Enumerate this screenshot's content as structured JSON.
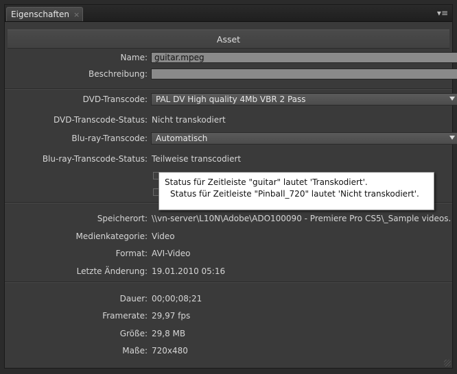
{
  "panel": {
    "tab_label": "Eigenschaften",
    "tab_close": "×",
    "menu_icon": "▾≡"
  },
  "section": {
    "title": "Asset"
  },
  "fields": {
    "name_label": "Name:",
    "name_value": "guitar.mpeg",
    "description_label": "Beschreibung:",
    "description_value": "",
    "dvd_transcode_label": "DVD-Transcode:",
    "dvd_transcode_value": "PAL DV High quality 4Mb VBR 2 Pass",
    "dvd_status_label": "DVD-Transcode-Status:",
    "dvd_status_value": "Nicht transkodiert",
    "bluray_transcode_label": "Blu-ray-Transcode:",
    "bluray_transcode_value": "Automatisch",
    "bluray_status_label": "Blu-ray-Transcode-Status:",
    "bluray_status_value": "Teilweise transcodiert"
  },
  "tooltip": {
    "line1": "Status für Zeitleiste \"guitar\" lautet 'Transkodiert'.",
    "line2": "Status für Zeitleiste \"Pinball_720\" lautet 'Nicht transkodiert'."
  },
  "file_info": {
    "location_label": "Speicherort:",
    "location_value": "\\\\vn-server\\L10N\\Adobe\\ADO100090 - Premiere Pro CS5\\_Sample videos...",
    "media_category_label": "Medienkategorie:",
    "media_category_value": "Video",
    "format_label": "Format:",
    "format_value": "AVI-Video",
    "last_modified_label": "Letzte Änderung:",
    "last_modified_value": "19.01.2010 05:16"
  },
  "media_info": {
    "duration_label": "Dauer:",
    "duration_value": "00;00;08;21",
    "framerate_label": "Framerate:",
    "framerate_value": "29,97 fps",
    "size_label": "Größe:",
    "size_value": "29,8 MB",
    "dimensions_label": "Maße:",
    "dimensions_value": "720x480"
  },
  "colors": {
    "panel_bg": "#3a3a3a",
    "field_bg": "#8a8a8a",
    "tooltip_bg": "#ffffff"
  }
}
